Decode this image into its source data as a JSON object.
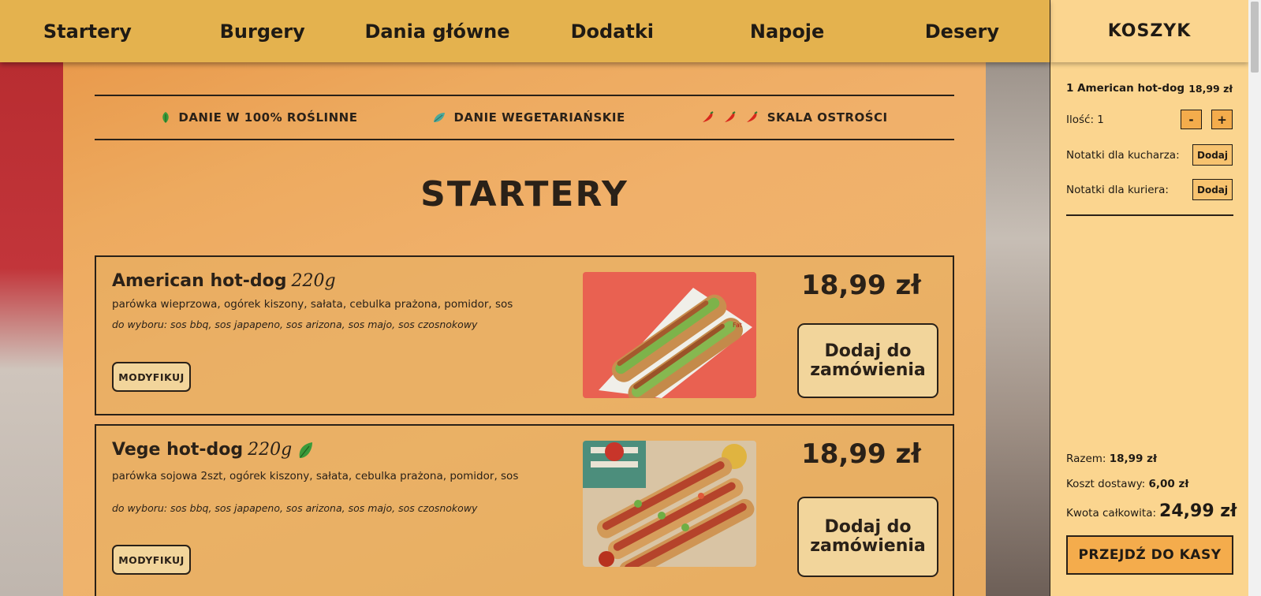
{
  "nav": {
    "items": [
      {
        "label": "Startery"
      },
      {
        "label": "Burgery"
      },
      {
        "label": "Dania główne"
      },
      {
        "label": "Dodatki"
      },
      {
        "label": "Napoje"
      },
      {
        "label": "Desery"
      }
    ]
  },
  "legend": {
    "vegan": "DANIE W 100% ROŚLINNE",
    "vegetarian": "DANIE WEGETARIAŃSKIE",
    "spicy": "SKALA OSTROŚCI"
  },
  "section_title": "STARTERY",
  "products": [
    {
      "name": "American hot-dog",
      "weight": "220g",
      "description": "parówka wieprzowa, ogórek kiszony, sałata, cebulka prażona, pomidor, sos",
      "choice": "do wyboru: sos bbq, sos japapeno, sos arizona, sos majo, sos czosnokowy",
      "price": "18,99 zł",
      "modify_label": "MODYFIKUJ",
      "add_label": "Dodaj do zamówienia",
      "vegan": false
    },
    {
      "name": "Vege hot-dog",
      "weight": "220g",
      "description": "parówka sojowa 2szt, ogórek kiszony, sałata, cebulka prażona, pomidor, sos",
      "choice": "do wyboru: sos bbq, sos japapeno, sos arizona, sos majo, sos czosnokowy",
      "price": "18,99 zł",
      "modify_label": "MODYFIKUJ",
      "add_label": "Dodaj do zamówienia",
      "vegan": true
    }
  ],
  "cart": {
    "title": "KOSZYK",
    "item_name": "1 American hot-dog",
    "item_price": "18,99 zł",
    "qty_label": "Ilość: 1",
    "minus": "-",
    "plus": "+",
    "cook_notes_label": "Notatki dla kucharza:",
    "courier_notes_label": "Notatki dla kuriera:",
    "add_note": "Dodaj",
    "subtotal_label": "Razem:",
    "subtotal_value": "18,99 zł",
    "delivery_label": "Koszt dostawy:",
    "delivery_value": "6,00 zł",
    "total_label": "Kwota całkowita:",
    "total_value": "24,99 zł",
    "checkout_label": "PRZEJDŹ DO KASY"
  },
  "colors": {
    "nav_bg": "#e4b24e",
    "cart_bg": "#fbd58f",
    "accent_button": "#f4ac4c",
    "text": "#2a2118",
    "leaf_vegan": "#3a9a3a",
    "leaf_vegetarian": "#4aa89a",
    "chili": "#d8281c"
  }
}
